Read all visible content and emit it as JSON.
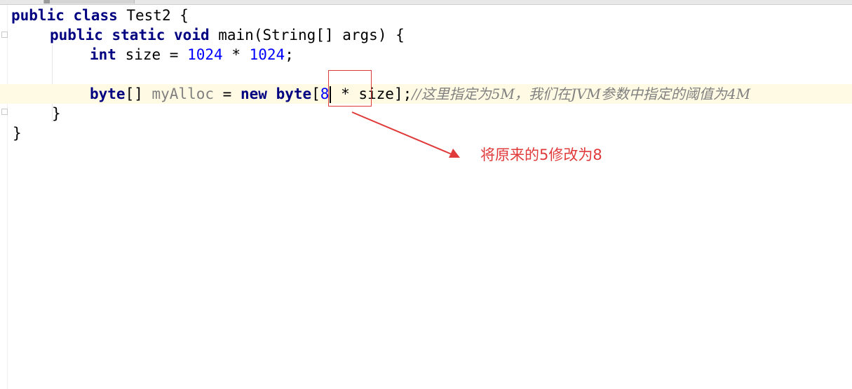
{
  "editor": {
    "line1": {
      "kw_public": "public",
      "kw_class": "class",
      "rest": " Test2 {"
    },
    "line2": {
      "kw_public": "public",
      "kw_static": "static",
      "kw_void": "void",
      "rest": " main(String[] args) {"
    },
    "line3": {
      "kw_int": "int",
      "mid": " size = ",
      "num1": "1024",
      "op": " * ",
      "num2": "1024",
      "end": ";"
    },
    "line5": {
      "kw_byte": "byte",
      "brackets": "[] ",
      "var": "myAlloc",
      "assign": " = ",
      "kw_new": "new",
      "kw_byte2": "byte",
      "open": "[",
      "num": "8",
      "after": " * size];",
      "comment": "//这里指定为5M，我们在JVM参数中指定的阈值为4M"
    },
    "line6": {
      "brace": "}"
    },
    "line7": {
      "brace": "}"
    }
  },
  "annotation": {
    "text": "将原来的5修改为8",
    "color": "#e03a3a"
  },
  "colors": {
    "keyword": "#000080",
    "number": "#0000ff",
    "comment": "#808080",
    "current_line": "#fffae3"
  }
}
